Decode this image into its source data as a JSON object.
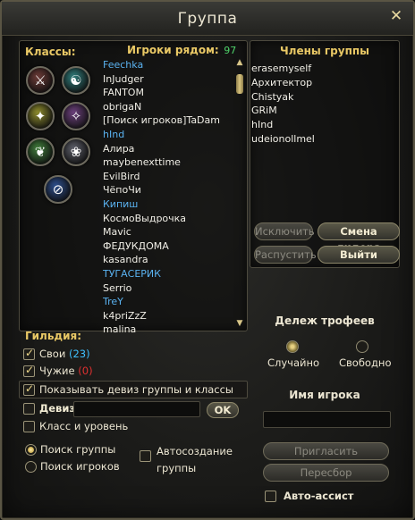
{
  "window": {
    "title": "Группа",
    "close_glyph": "✕"
  },
  "left": {
    "classes_label": "Классы:",
    "class_icons": [
      {
        "name": "warrior-class-icon",
        "glyph": "⚔",
        "color": "#6a3a36"
      },
      {
        "name": "mage-class-icon",
        "glyph": "☯",
        "color": "#2f7a78"
      },
      {
        "name": "archer-class-icon",
        "glyph": "✦",
        "color": "#8c8a2c"
      },
      {
        "name": "priest-class-icon",
        "glyph": "✧",
        "color": "#6a3f7a"
      },
      {
        "name": "druid-class-icon",
        "glyph": "❦",
        "color": "#3f7a3a"
      },
      {
        "name": "rogue-class-icon",
        "glyph": "❀",
        "color": "#5a5c66"
      },
      {
        "name": "all-classes-icon",
        "glyph": "⊘",
        "color": "#2d4d8a"
      }
    ]
  },
  "nearby": {
    "label": "Игроки рядом:",
    "count": "97",
    "players": [
      {
        "name": "Feechka",
        "blue": true
      },
      {
        "name": "InJudger",
        "blue": false
      },
      {
        "name": "FANTOM",
        "blue": false
      },
      {
        "name": "obrigaN",
        "blue": false
      },
      {
        "name": "[Поиск игроков]TaDam",
        "blue": false
      },
      {
        "name": "hInd",
        "blue": true
      },
      {
        "name": "Алира",
        "blue": false
      },
      {
        "name": "maybenexttime",
        "blue": false
      },
      {
        "name": "EvilBird",
        "blue": false
      },
      {
        "name": "ЧёпоЧи",
        "blue": false
      },
      {
        "name": "Кипиш",
        "blue": true
      },
      {
        "name": "КосмоВыдрочка",
        "blue": false
      },
      {
        "name": "Mavic",
        "blue": false
      },
      {
        "name": "ФЕДУКДОМА",
        "blue": false
      },
      {
        "name": "kasandra",
        "blue": false
      },
      {
        "name": "ТУГАСЕРИК",
        "blue": true
      },
      {
        "name": "Serrio",
        "blue": false
      },
      {
        "name": "TreY",
        "blue": true
      },
      {
        "name": "k4priZzZ",
        "blue": false
      },
      {
        "name": "malina",
        "blue": false
      }
    ]
  },
  "members": {
    "label": "Члены группы",
    "list": [
      "erasemyself",
      "Архитектор",
      "Chistyak",
      "GRiM",
      "hInd",
      "udeionollmel"
    ]
  },
  "buttons": {
    "kick": "Исключить",
    "change_leader": "Смена лидера",
    "disband": "Распустить",
    "leave": "Выйти",
    "invite": "Пригласить",
    "reroll": "Пересбор",
    "ok": "OK"
  },
  "guild": {
    "label": "Гильдия:",
    "own_label": "Свои",
    "own_count": "(23)",
    "other_label": "Чужие",
    "other_count": "(0)",
    "show_motto_label": "Показывать девиз группы и классы",
    "motto_label": "Девиз",
    "motto_value": "",
    "class_level_label": "Класс и уровень"
  },
  "search": {
    "find_group": "Поиск группы",
    "find_players": "Поиск игроков",
    "auto_create": "Автосоздание группы"
  },
  "loot": {
    "label": "Дележ трофеев",
    "random": "Случайно",
    "free": "Свободно"
  },
  "player_name": {
    "label": "Имя игрока",
    "value": ""
  },
  "auto_assist": {
    "label": "Авто-ассист"
  },
  "colors": {
    "gold": "#e9c865",
    "blue_name": "#5ab2f0",
    "count_green": "#4fd36a",
    "own_count": "#3fc0ff",
    "other_count": "#e03030"
  }
}
